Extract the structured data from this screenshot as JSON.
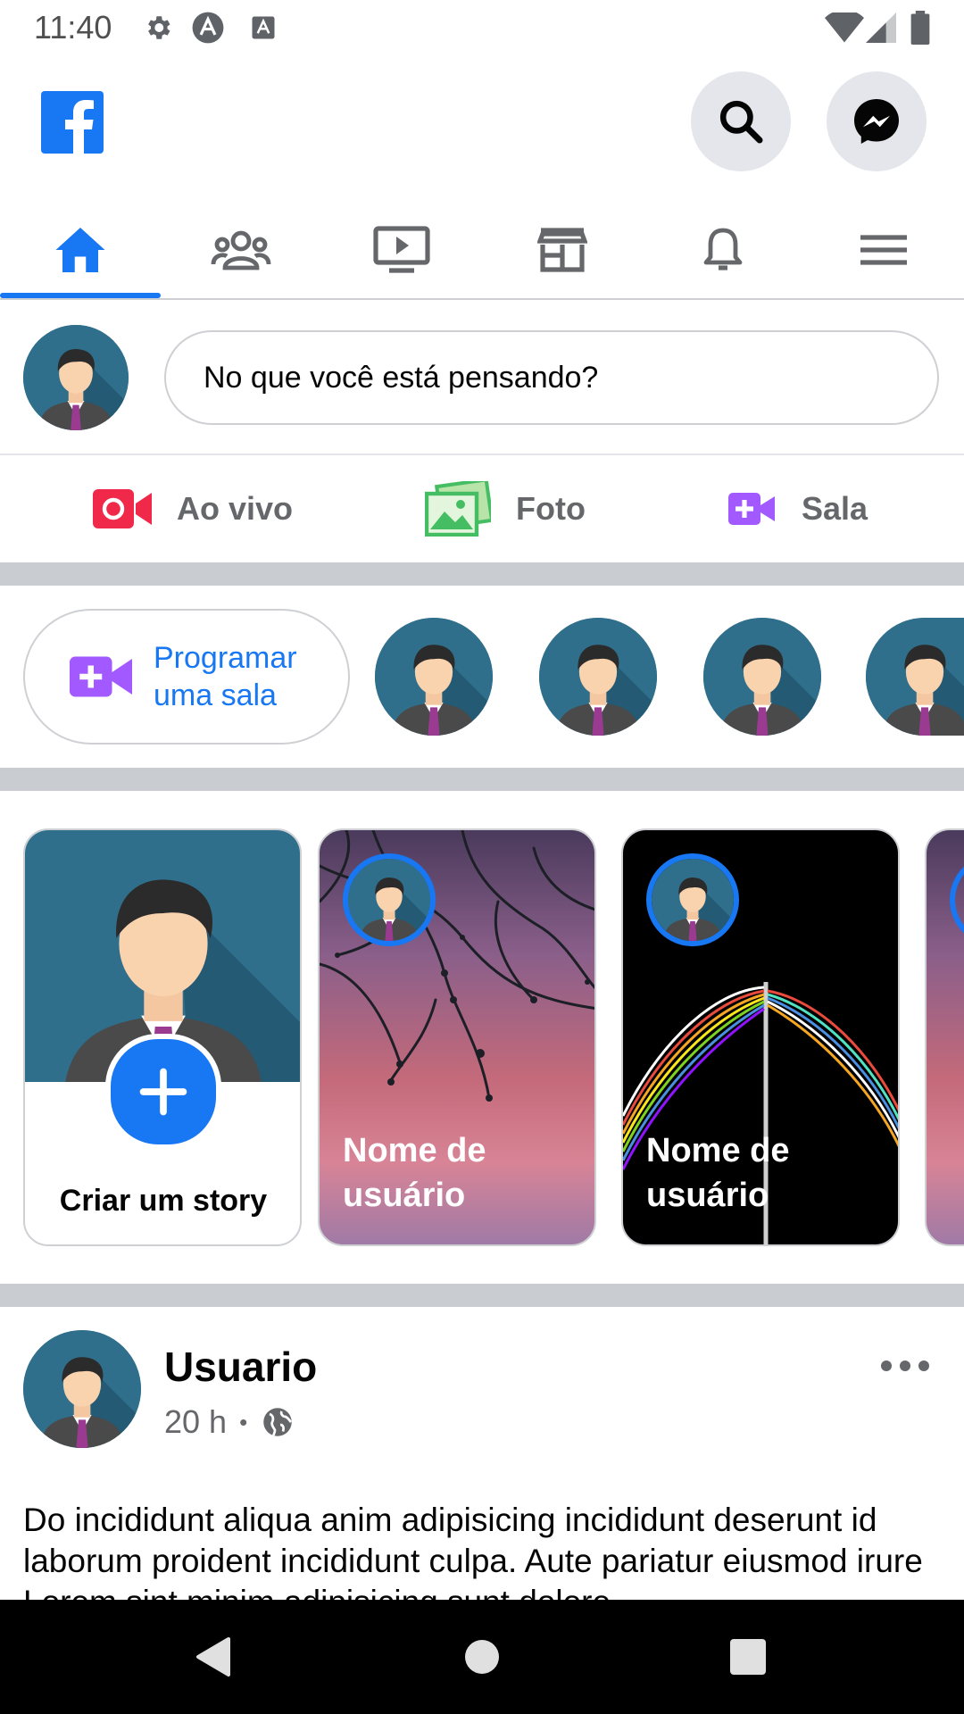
{
  "status_bar": {
    "time": "11:40"
  },
  "composer": {
    "placeholder": "No que você está pensando?"
  },
  "actions": [
    {
      "label": "Ao vivo",
      "icon": "live-video-icon",
      "color": "#f02849"
    },
    {
      "label": "Foto",
      "icon": "photo-icon",
      "color": "#45bd62"
    },
    {
      "label": "Sala",
      "icon": "room-icon",
      "color": "#a259ff"
    }
  ],
  "rooms": {
    "create_label_line1": "Programar",
    "create_label_line2": "uma sala"
  },
  "stories": {
    "create_label": "Criar um story",
    "items": [
      {
        "name_line1": "Nome de",
        "name_line2": "usuário"
      },
      {
        "name_line1": "Nome de",
        "name_line2": "usuário"
      }
    ]
  },
  "post": {
    "author": "Usuario",
    "time": "20 h",
    "separator": "•",
    "text": "Do incididunt aliqua anim adipisicing incididunt deserunt id laborum proident incididunt culpa. Aute pariatur eiusmod irure Lorem sint minim adipisicing sunt dolore"
  },
  "colors": {
    "brand": "#1877f2",
    "divider": "#c9ccd1",
    "secondary_text": "#65676b"
  }
}
